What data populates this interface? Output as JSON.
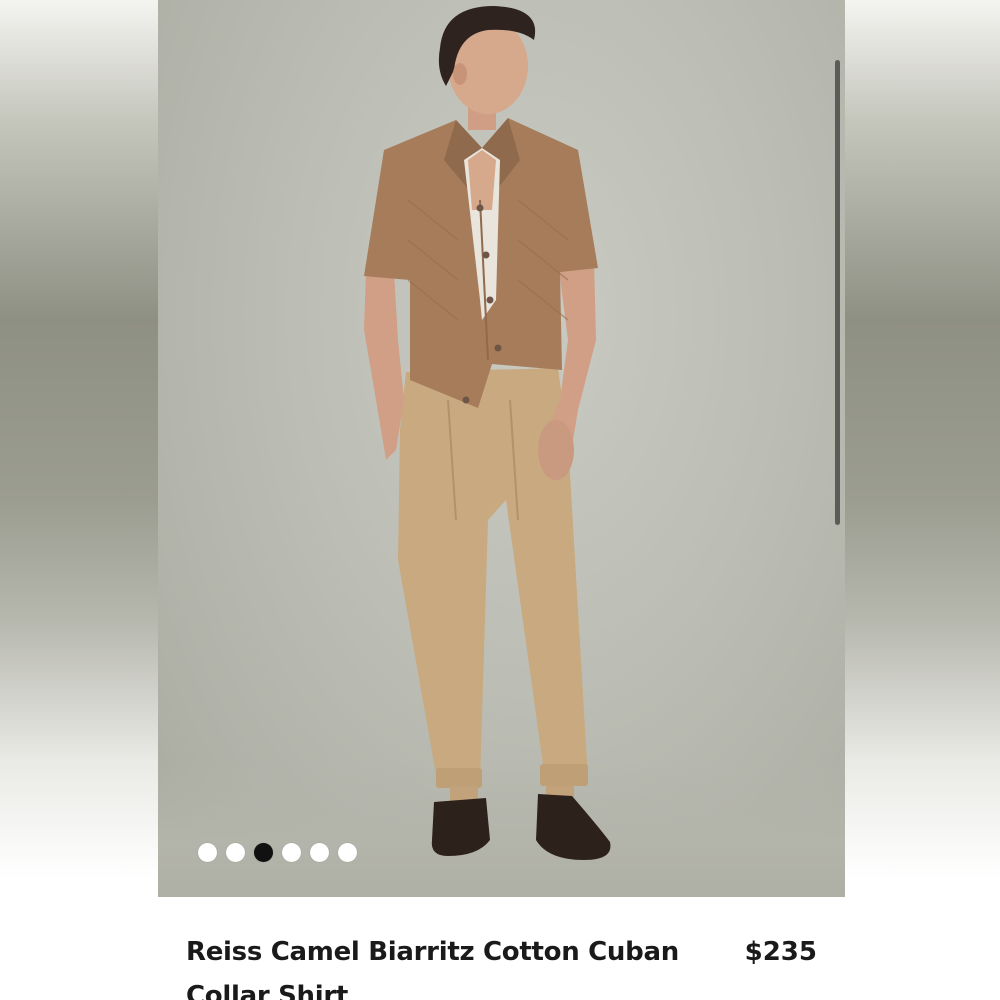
{
  "product": {
    "title": "Reiss Camel Biarritz Cotton Cuban Collar Shirt",
    "price": "$235",
    "image_alt": "Model wearing camel knit short-sleeve cuban collar shirt, white tank, beige pleated trousers and brown loafers"
  },
  "carousel": {
    "total_images": 6,
    "active_index": 2
  },
  "colors": {
    "shirt": "#a67c5b",
    "trousers": "#c9a97f",
    "shoes": "#2d211b",
    "background": "#bcbeb5"
  }
}
